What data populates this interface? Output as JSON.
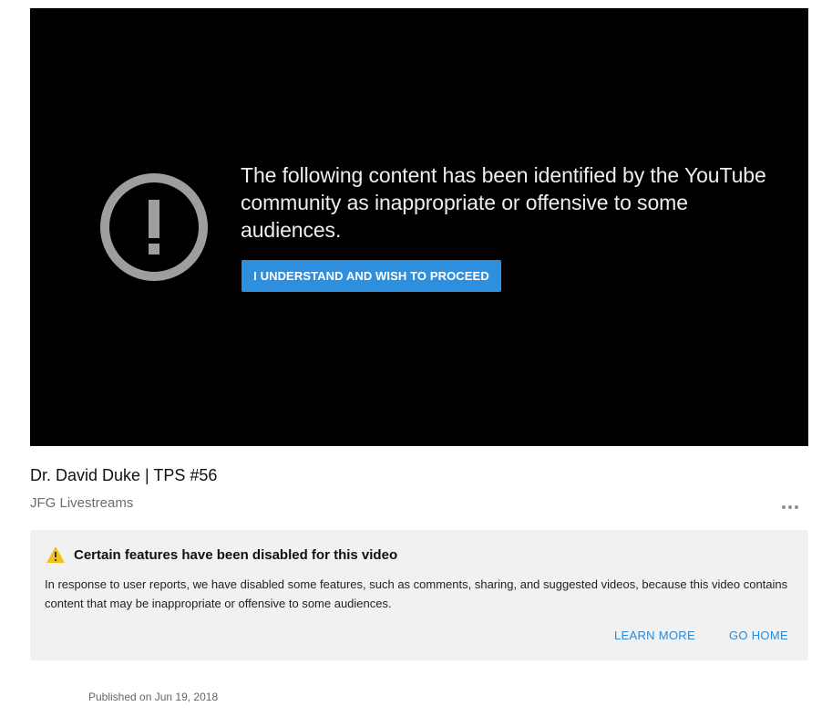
{
  "player": {
    "warning_message": "The following content has been identified by the YouTube community as inappropriate or offensive to some audiences.",
    "proceed_label": "I UNDERSTAND AND WISH TO PROCEED",
    "warning_icon": "exclamation-circle-icon"
  },
  "video": {
    "title": "Dr. David Duke | TPS #56",
    "channel": "JFG Livestreams",
    "more_icon": "more-horizontal-icon"
  },
  "notice": {
    "icon": "warning-triangle-icon",
    "title": "Certain features have been disabled for this video",
    "body": "In response to user reports, we have disabled some features, such as comments, sharing, and suggested videos, because this video contains content that may be inappropriate or offensive to some audiences.",
    "learn_more": "LEARN MORE",
    "go_home": "GO HOME"
  },
  "published": "Published on Jun 19, 2018",
  "colors": {
    "player_background": "#000000",
    "button_blue": "#2f8fdf",
    "link_blue": "#2a8ad6",
    "warning_yellow": "#f2c21b",
    "panel_background": "#f1f1f1"
  }
}
